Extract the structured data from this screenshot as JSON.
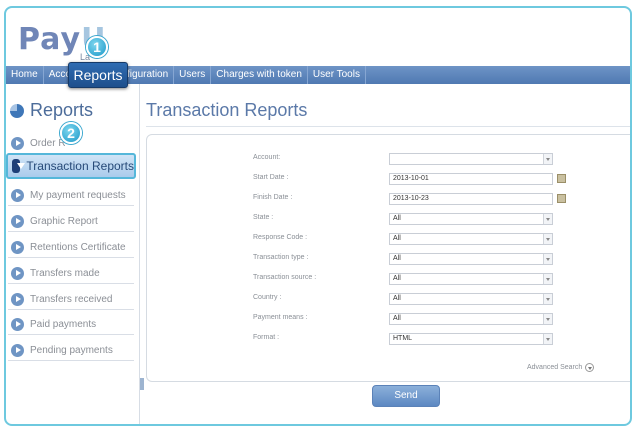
{
  "brand": {
    "logo_main": "Pay",
    "logo_accent": "U",
    "logo_sub": "La"
  },
  "topnav": {
    "items": [
      "Home",
      "Accou",
      "Configuration",
      "Users",
      "Charges with token",
      "User Tools"
    ],
    "active_label": "Reports"
  },
  "badges": {
    "step1": "1",
    "step2": "2"
  },
  "sidebar": {
    "title": "Reports",
    "items": [
      "Order R",
      "My payment requests",
      "Graphic Report",
      "Retentions Certificate",
      "Transfers made",
      "Transfers received",
      "Paid payments",
      "Pending payments"
    ],
    "active_label": "Transaction Reports"
  },
  "main": {
    "title": "Transaction Reports",
    "form": [
      {
        "label": "Account:",
        "value": "",
        "type": "select"
      },
      {
        "label": "Start Date :",
        "value": "2013-10-01",
        "type": "date"
      },
      {
        "label": "Finish Date :",
        "value": "2013-10-23",
        "type": "date"
      },
      {
        "label": "State :",
        "value": "All",
        "type": "select"
      },
      {
        "label": "Response Code :",
        "value": "All",
        "type": "select"
      },
      {
        "label": "Transaction type :",
        "value": "All",
        "type": "select"
      },
      {
        "label": "Transaction source :",
        "value": "All",
        "type": "select"
      },
      {
        "label": "Country :",
        "value": "All",
        "type": "select"
      },
      {
        "label": "Payment means :",
        "value": "All",
        "type": "select"
      },
      {
        "label": "Format :",
        "value": "HTML",
        "type": "select"
      }
    ],
    "advanced_search": "Advanced Search",
    "send_label": "Send"
  },
  "colors": {
    "accent": "#4f79b2",
    "highlight": "#55b7da"
  }
}
